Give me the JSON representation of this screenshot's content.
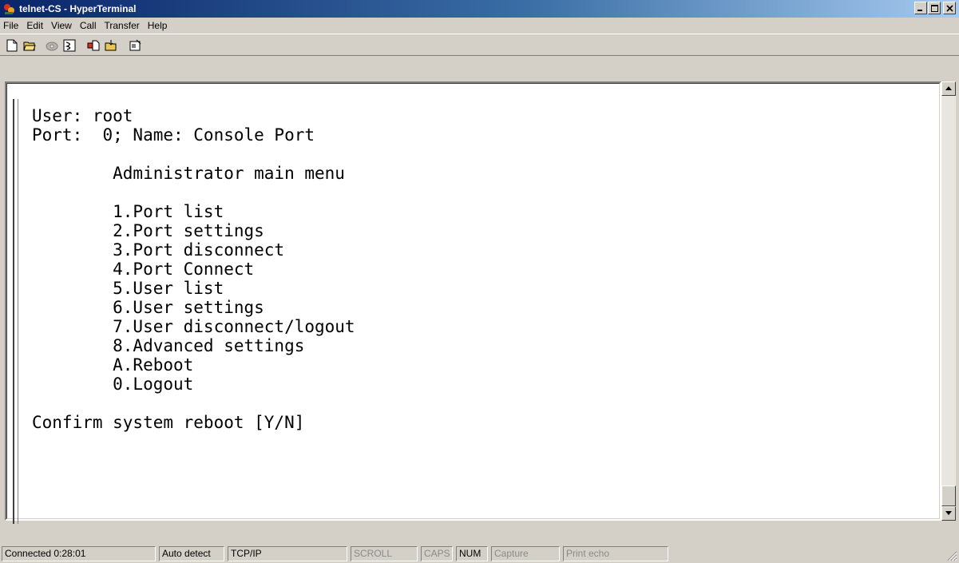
{
  "window": {
    "title": "telnet-CS - HyperTerminal"
  },
  "menu": [
    "File",
    "Edit",
    "View",
    "Call",
    "Transfer",
    "Help"
  ],
  "terminal": {
    "lines": [
      "User: root",
      "Port:  0; Name: Console Port",
      "",
      "        Administrator main menu",
      "",
      "        1.Port list",
      "        2.Port settings",
      "        3.Port disconnect",
      "        4.Port Connect",
      "        5.User list",
      "        6.User settings",
      "        7.User disconnect/logout",
      "        8.Advanced settings",
      "        A.Reboot",
      "        0.Logout",
      "",
      "Confirm system reboot [Y/N]"
    ]
  },
  "status": {
    "connected": "Connected 0:28:01",
    "detect": "Auto detect",
    "protocol": "TCP/IP",
    "scroll": "SCROLL",
    "caps": "CAPS",
    "num": "NUM",
    "capture": "Capture",
    "print_echo": "Print echo"
  },
  "colors": {
    "titlebar": "#0a246a",
    "titlebar_end": "#a6caf0",
    "chrome": "#d4d0c8",
    "terminal_bg": "#ffffff"
  }
}
